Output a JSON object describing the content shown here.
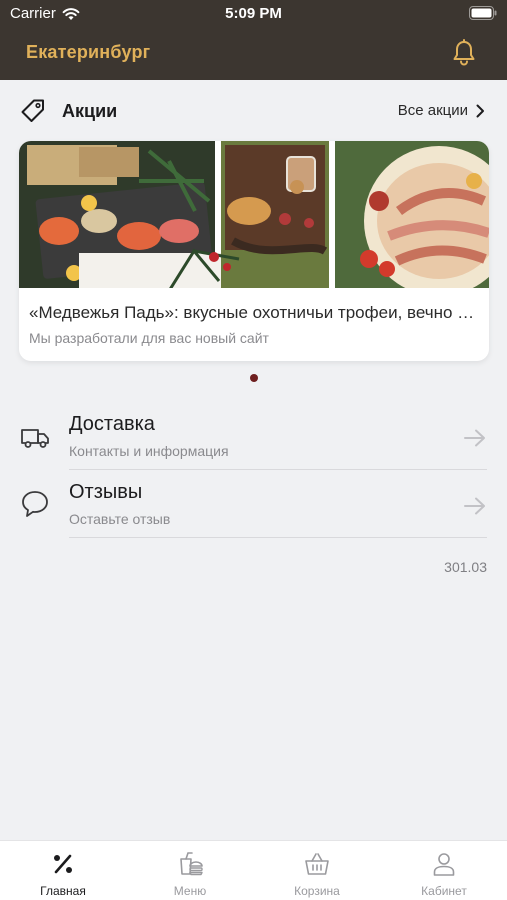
{
  "status_bar": {
    "carrier": "Carrier",
    "time": "5:09 PM"
  },
  "header": {
    "city": "Екатеринбург"
  },
  "promotions": {
    "title": "Акции",
    "all_link": "Все акции",
    "card": {
      "title": "«Медвежья Падь»: вкусные охотничьи трофеи, вечно свежие",
      "subtitle": "Мы разработали для вас новый сайт"
    }
  },
  "list": [
    {
      "title": "Доставка",
      "subtitle": "Контакты и информация",
      "icon": "truck-icon"
    },
    {
      "title": "Отзывы",
      "subtitle": "Оставьте отзыв",
      "icon": "speech-bubble-icon"
    }
  ],
  "version": "301.03",
  "tabs": [
    {
      "label": "Главная",
      "icon": "percent-icon",
      "active": true
    },
    {
      "label": "Меню",
      "icon": "menu-food-icon",
      "active": false
    },
    {
      "label": "Корзина",
      "icon": "basket-icon",
      "active": false
    },
    {
      "label": "Кабинет",
      "icon": "user-icon",
      "active": false
    }
  ],
  "colors": {
    "header_bg": "#3c3630",
    "accent": "#e0b15a",
    "dot_active": "#6e1f1f"
  }
}
